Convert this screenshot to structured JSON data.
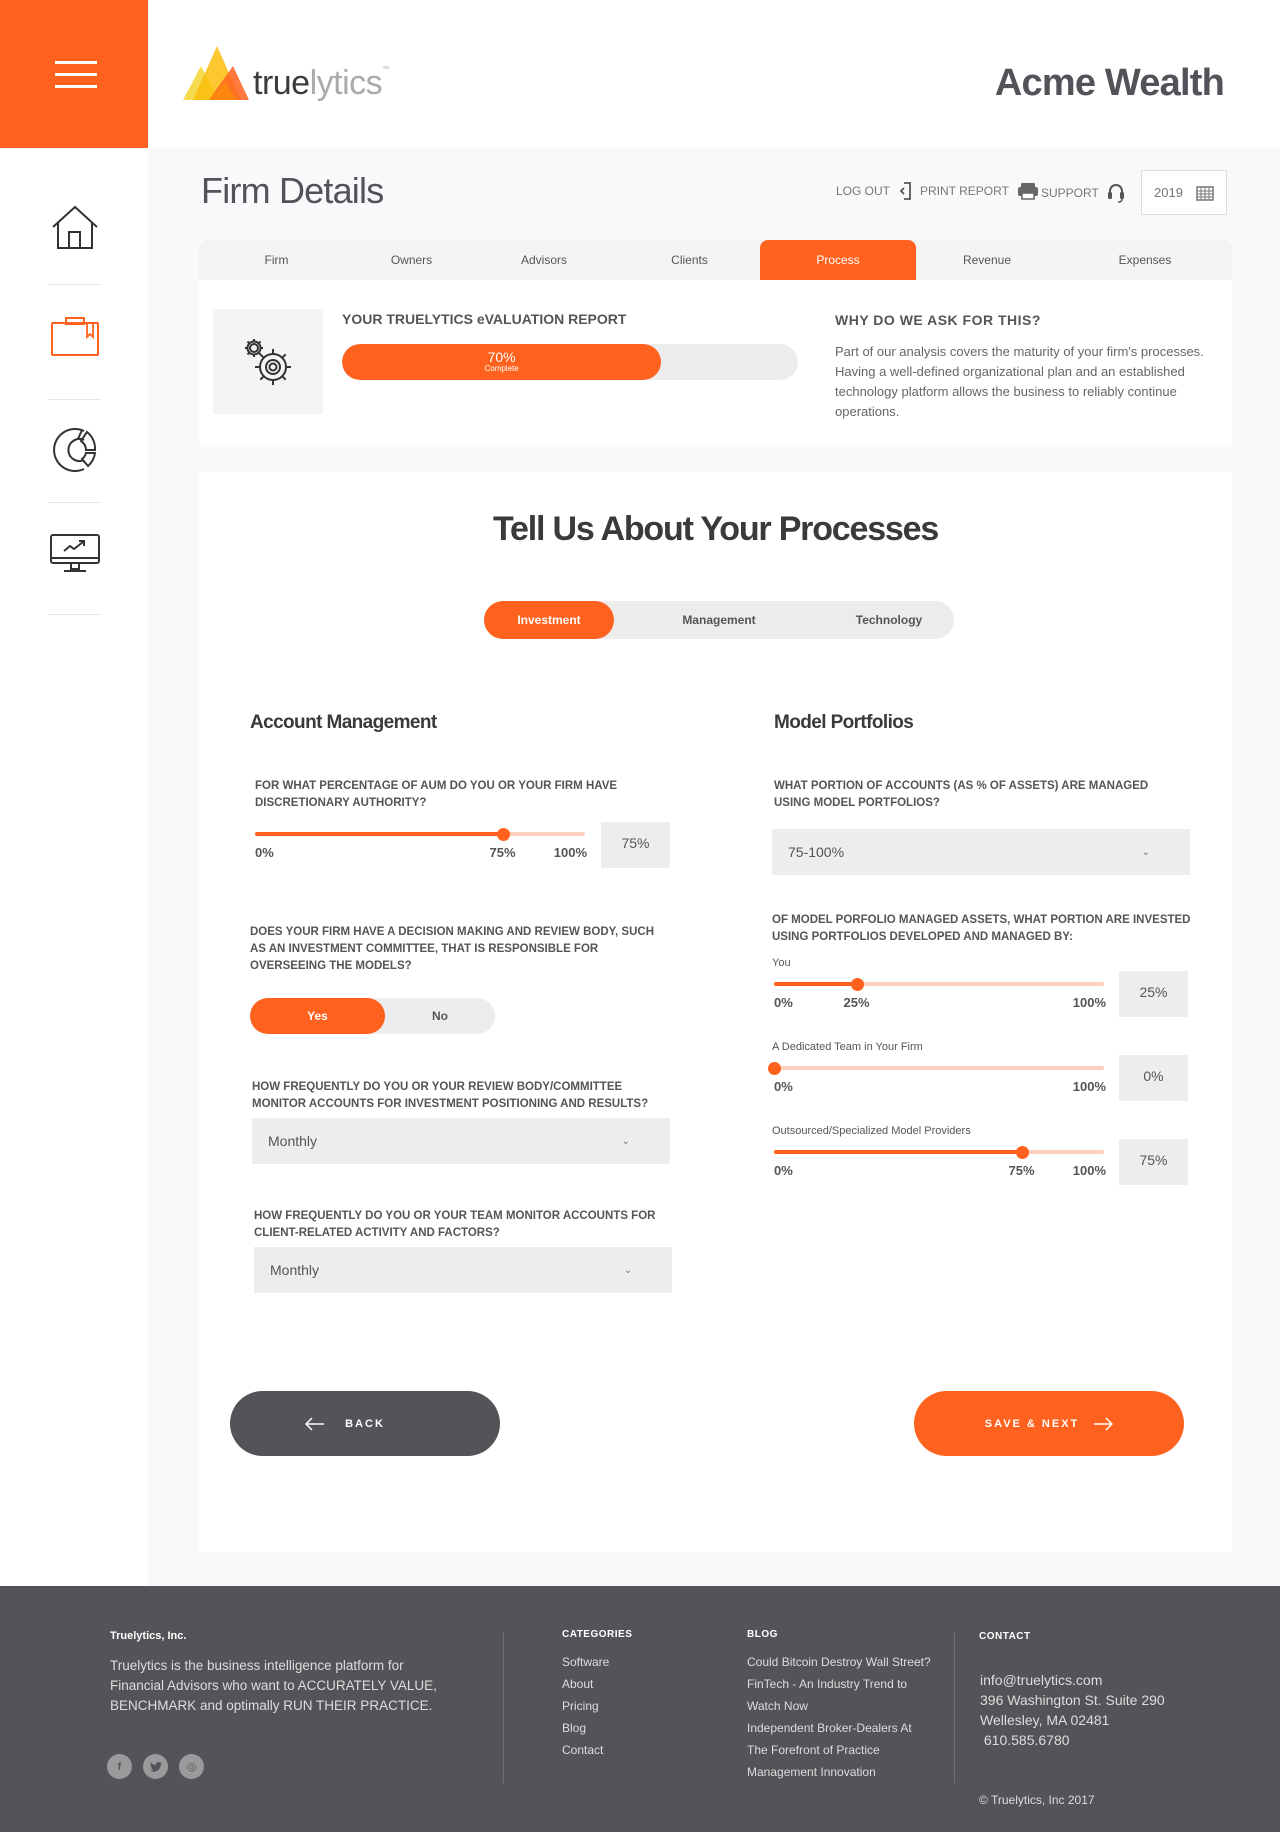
{
  "header": {
    "menu_icon": "hamburger-menu-icon",
    "logo": {
      "bold": "true",
      "light": "lytics",
      "tm": "™"
    },
    "company_name": "Acme Wealth"
  },
  "sidebar": {
    "items": [
      {
        "name": "home",
        "icon": "home-icon",
        "active": false
      },
      {
        "name": "firm-details",
        "icon": "briefcase-icon",
        "active": true
      },
      {
        "name": "reports",
        "icon": "donut-chart-icon",
        "active": false
      },
      {
        "name": "analytics",
        "icon": "monitor-chart-icon",
        "active": false
      }
    ]
  },
  "page": {
    "title": "Firm Details",
    "toolbar": {
      "logout": "LOG OUT",
      "print": "PRINT REPORT",
      "support": "SUPPORT",
      "year": "2019"
    }
  },
  "tabs": [
    {
      "label": "Firm",
      "active": false
    },
    {
      "label": "Owners",
      "active": false
    },
    {
      "label": "Advisors",
      "active": false
    },
    {
      "label": "Clients",
      "active": false
    },
    {
      "label": "Process",
      "active": true
    },
    {
      "label": "Revenue",
      "active": false
    },
    {
      "label": "Expenses",
      "active": false
    }
  ],
  "report": {
    "title": "YOUR TRUELYTICS eVALUATION REPORT",
    "progress_percent": 70,
    "progress_label": "70%",
    "progress_sublabel": "Complete"
  },
  "why": {
    "title": "WHY DO WE ASK FOR THIS?",
    "text": "Part of our analysis covers the maturity of your firm's processes. Having a well-defined organizational plan and an established technology platform allows the business to reliably continue operations."
  },
  "form": {
    "title": "Tell Us About Your Processes",
    "subtabs": [
      {
        "label": "Investment",
        "active": true
      },
      {
        "label": "Management",
        "active": false
      },
      {
        "label": "Technology",
        "active": false
      }
    ],
    "account_management": {
      "title": "Account Management",
      "q1": {
        "label": "FOR WHAT PERCENTAGE OF AUM DO YOU OR YOUR FIRM HAVE DISCRETIONARY AUTHORITY?",
        "value": 75,
        "min_label": "0%",
        "value_label": "75%",
        "max_label": "100%",
        "box_value": "75%"
      },
      "q2": {
        "label": "DOES YOUR FIRM HAVE A DECISION MAKING AND REVIEW BODY, SUCH AS AN INVESTMENT COMMITTEE, THAT IS RESPONSIBLE FOR OVERSEEING THE MODELS?",
        "options": [
          "Yes",
          "No"
        ],
        "selected": "Yes"
      },
      "q3": {
        "label": "HOW FREQUENTLY DO YOU OR YOUR REVIEW BODY/COMMITTEE MONITOR ACCOUNTS FOR INVESTMENT POSITIONING AND RESULTS?",
        "value": "Monthly"
      },
      "q4": {
        "label": "HOW FREQUENTLY DO YOU OR YOUR TEAM MONITOR ACCOUNTS FOR CLIENT-RELATED ACTIVITY AND FACTORS?",
        "value": "Monthly"
      }
    },
    "model_portfolios": {
      "title": "Model Portfolios",
      "q1": {
        "label": "WHAT PORTION OF ACCOUNTS (AS % OF ASSETS) ARE MANAGED USING MODEL PORTFOLIOS?",
        "value": "75-100%"
      },
      "q2": {
        "label": "OF MODEL PORFOLIO MANAGED ASSETS, WHAT PORTION  ARE INVESTED USING PORTFOLIOS DEVELOPED AND MANAGED BY:",
        "sliders": [
          {
            "label": "You",
            "value": 25,
            "min_label": "0%",
            "value_label": "25%",
            "max_label": "100%",
            "box_value": "25%"
          },
          {
            "label": "A Dedicated Team in Your Firm",
            "value": 0,
            "min_label": "0%",
            "value_label": "",
            "max_label": "100%",
            "box_value": "0%"
          },
          {
            "label": "Outsourced/Specialized Model Providers",
            "value": 75,
            "min_label": "0%",
            "value_label": "75%",
            "max_label": "100%",
            "box_value": "75%"
          }
        ]
      }
    },
    "back_label": "BACK",
    "next_label": "SAVE & NEXT"
  },
  "footer": {
    "company": "Truelytics, Inc.",
    "about": "Truelytics is the business intelligence platform for Financial Advisors who want to ACCURATELY VALUE, BENCHMARK and optimally RUN THEIR PRACTICE.",
    "social": [
      {
        "icon": "facebook-icon",
        "glyph": "f"
      },
      {
        "icon": "twitter-icon",
        "glyph": "t"
      },
      {
        "icon": "dribbble-icon",
        "glyph": "◎"
      }
    ],
    "categories_title": "CATEGORIES",
    "categories": [
      "Software",
      "About",
      "Pricing",
      "Blog",
      "Contact"
    ],
    "blog_title": "BLOG",
    "blog_lines": [
      "Could Bitcoin Destroy Wall Street?",
      "FinTech - An Industry Trend to",
      "Watch Now",
      "Independent Broker-Dealers At",
      "The Forefront of Practice",
      "Management Innovation"
    ],
    "contact_title": "CONTACT",
    "contact": {
      "email": "info@truelytics.com",
      "address1": "396 Washington St. Suite 290",
      "address2": "Wellesley, MA 02481",
      "phone": " 610.585.6780"
    },
    "copyright": "© Truelytics, Inc  2017"
  },
  "colors": {
    "accent": "#ff611e",
    "accent_light": "#fdd0bd",
    "dark": "#535458",
    "text": "#555555"
  }
}
